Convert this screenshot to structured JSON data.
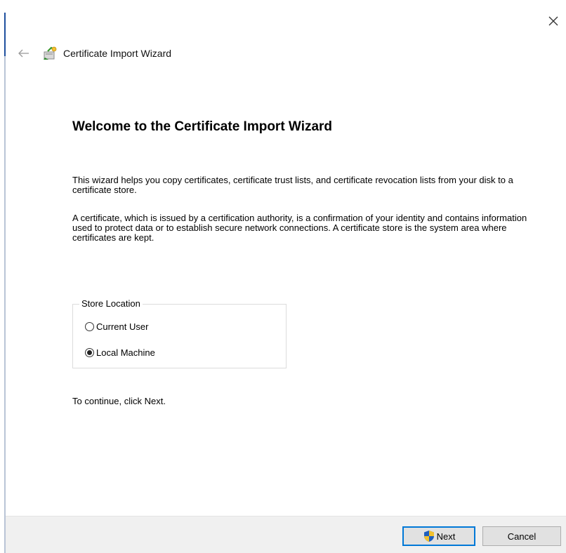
{
  "window": {
    "title": "Certificate Import Wizard",
    "close_glyph": "✕",
    "back_glyph": "←"
  },
  "content": {
    "heading": "Welcome to the Certificate Import Wizard",
    "paragraph1": "This wizard helps you copy certificates, certificate trust lists, and certificate revocation lists from your disk to a certificate store.",
    "paragraph2": "A certificate, which is issued by a certification authority, is a confirmation of your identity and contains information used to protect data or to establish secure network connections. A certificate store is the system area where certificates are kept.",
    "continue_text": "To continue, click Next."
  },
  "store_location": {
    "legend": "Store Location",
    "options": [
      {
        "label": "Current User",
        "selected": false
      },
      {
        "label": "Local Machine",
        "selected": true
      }
    ]
  },
  "footer": {
    "next_label": "Next",
    "cancel_label": "Cancel"
  },
  "icons": {
    "close": "close-icon",
    "back": "back-arrow-icon",
    "certificate": "certificate-icon",
    "shield": "uac-shield-icon"
  },
  "colors": {
    "accent": "#0078d7",
    "footer_bg": "#f0f0f0",
    "button_bg": "#e1e1e1"
  }
}
